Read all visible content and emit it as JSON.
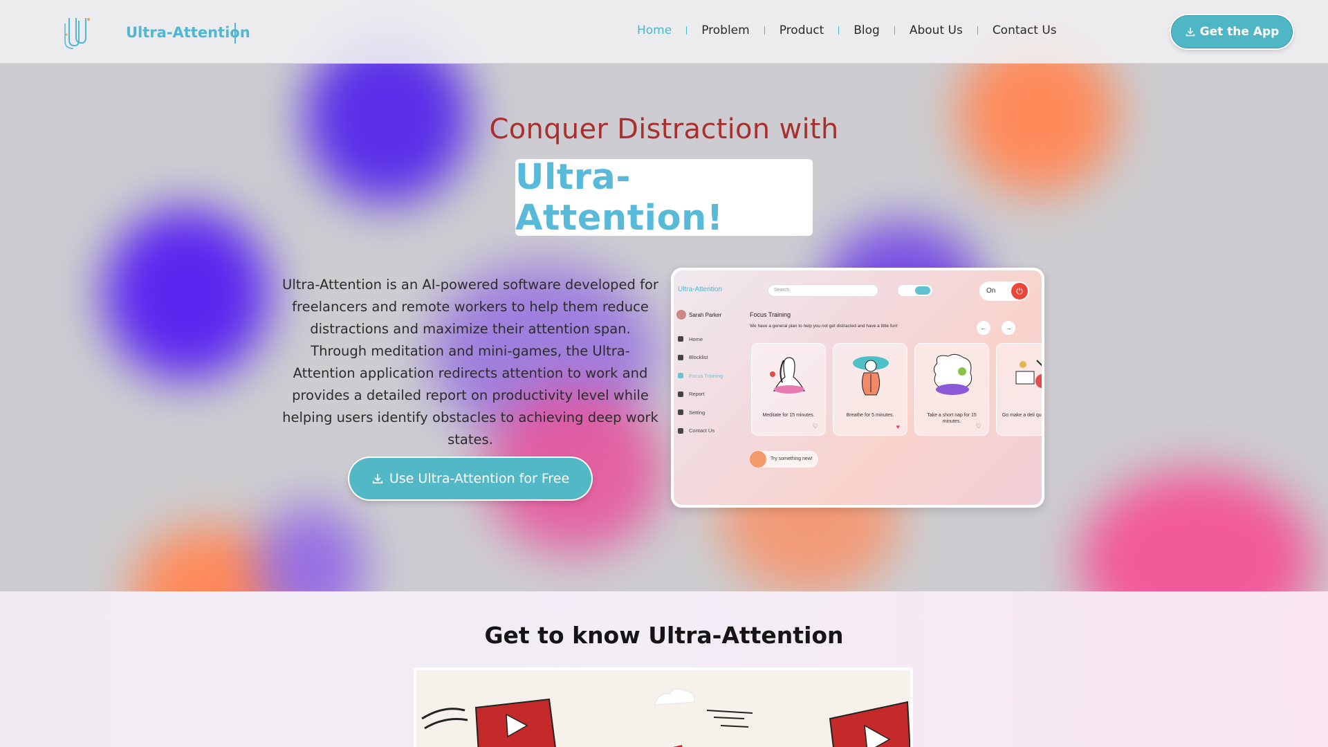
{
  "navbar": {
    "brand": "Ultra-Attention",
    "items": [
      {
        "label": "Home",
        "active": true
      },
      {
        "label": "Problem"
      },
      {
        "label": "Product"
      },
      {
        "label": "Blog"
      },
      {
        "label": "About Us"
      },
      {
        "label": "Contact Us"
      }
    ],
    "cta_label": "Get the App"
  },
  "hero": {
    "headline": "Conquer Distraction with",
    "brand_highlight": "Ultra-Attention!",
    "description": "Ultra-Attention is an AI-powered software developed for freelancers and remote workers to help them reduce distractions and maximize their attention span. Through meditation and mini-games, the Ultra-Attention application redirects attention to work and provides a detailed report on productivity level while helping users identify obstacles to achieving deep work states.",
    "cta_label": "Use Ultra-Attention for Free"
  },
  "app_preview": {
    "logo": "Ultra-Attention",
    "search_placeholder": "Search",
    "power_label": "On",
    "user_name": "Sarah Parker",
    "sidebar": [
      "Home",
      "Blocklist",
      "Focus Training",
      "Report",
      "Setting",
      "Contact Us"
    ],
    "active_sidebar": "Focus Training",
    "title": "Focus Training",
    "subtitle": "We have a general plan to help you not get distracted and have a little fun!",
    "cards": [
      {
        "caption": "Meditate for 15 minutes.",
        "liked": false
      },
      {
        "caption": "Breathe for 5 minutes.",
        "liked": true
      },
      {
        "caption": "Take a short nap for 15 minutes.",
        "liked": false
      },
      {
        "caption": "Go make a deli quick meal fo",
        "liked": false
      }
    ],
    "try_label": "Try something new!"
  },
  "section2": {
    "title": "Get to know Ultra-Attention"
  },
  "colors": {
    "accent": "#4fb6c6",
    "headline": "#a8302e",
    "brand": "#58b9d8"
  }
}
